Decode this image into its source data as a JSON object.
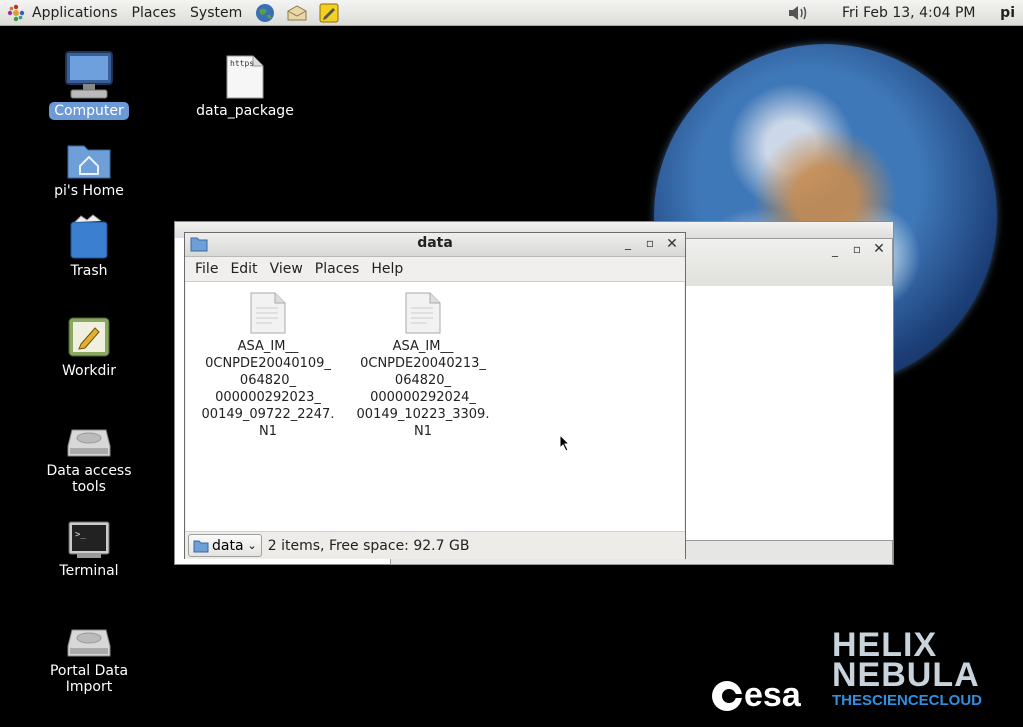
{
  "panel": {
    "menus": [
      "Applications",
      "Places",
      "System"
    ],
    "clock": "Fri Feb 13,  4:04 PM",
    "user": "pi"
  },
  "desktop": {
    "icons": [
      {
        "label": "Computer",
        "icon": "computer-icon"
      },
      {
        "label": "data_package",
        "icon": "file-icon",
        "text_on_icon": "https"
      },
      {
        "label": "pi's Home",
        "icon": "home-folder-icon"
      },
      {
        "label": "Trash",
        "icon": "trash-icon"
      },
      {
        "label": "Workdir",
        "icon": "workdir-icon"
      },
      {
        "label": "Data access tools",
        "icon": "drive-icon"
      },
      {
        "label": "Terminal",
        "icon": "terminal-icon"
      },
      {
        "label": "Portal Data Import",
        "icon": "drive-icon"
      }
    ]
  },
  "window": {
    "title": "data",
    "menu": [
      "File",
      "Edit",
      "View",
      "Places",
      "Help"
    ],
    "files": [
      {
        "name": "ASA_IM__\n0CNPDE20040109_\n064820_\n000000292023_\n00149_09722_2247.\nN1"
      },
      {
        "name": "ASA_IM__\n0CNPDE20040213_\n064820_\n000000292024_\n00149_10223_3309.\nN1"
      }
    ],
    "location": "data",
    "status": "2 items, Free space: 92.7 GB"
  },
  "logos": {
    "esa": "esa",
    "helix_line1": "HELIX",
    "helix_line2": "NEBULA",
    "helix_tagline": "THESCIENCECLOUD"
  },
  "colors": {
    "selection": "#6b9ad6",
    "desktop_bg": "#000000",
    "helix_blue": "#2f8fe0"
  }
}
